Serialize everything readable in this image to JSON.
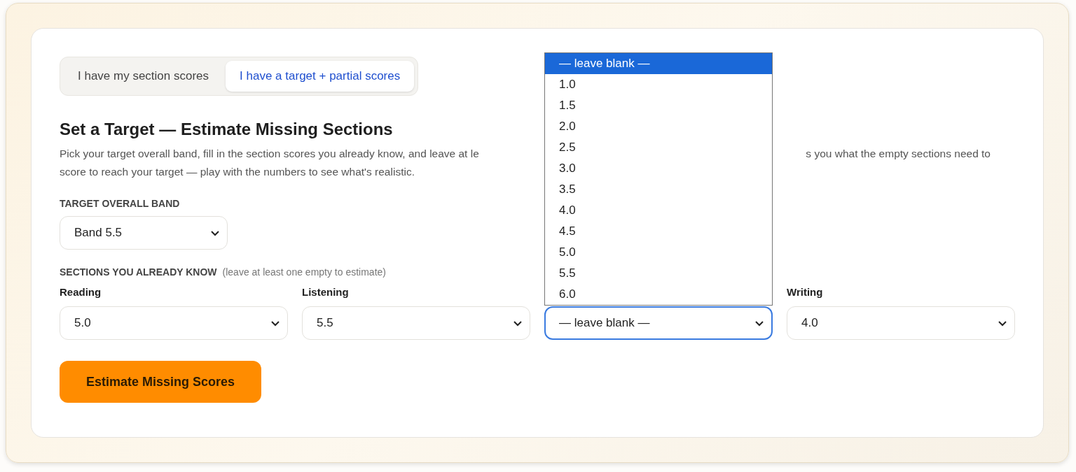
{
  "tabs": [
    {
      "label": "I have my section scores",
      "selected": false
    },
    {
      "label": "I have a target + partial scores",
      "selected": true
    }
  ],
  "heading": "Set a Target — Estimate Missing Sections",
  "description": {
    "line_1_start": "Pick your target overall band, fill in the section scores you already know, and leave at le",
    "line_1_end": "s you what the empty sections need to",
    "line_2": "score to reach your target — play with the numbers to see what's realistic."
  },
  "target": {
    "label": "TARGET OVERALL BAND",
    "value": "Band 5.5"
  },
  "sections": {
    "label": "SECTIONS YOU ALREADY KNOW",
    "hint": "(leave at least one empty to estimate)",
    "fields": [
      {
        "label": "Reading",
        "value": "5.0",
        "focused": false
      },
      {
        "label": "Listening",
        "value": "5.5",
        "focused": false
      },
      {
        "value": "— leave blank —",
        "focused": true,
        "options": [
          {
            "label": "— leave blank —",
            "selected": true
          },
          {
            "label": "1.0",
            "selected": false
          },
          {
            "label": "1.5",
            "selected": false
          },
          {
            "label": "2.0",
            "selected": false
          },
          {
            "label": "2.5",
            "selected": false
          },
          {
            "label": "3.0",
            "selected": false
          },
          {
            "label": "3.5",
            "selected": false
          },
          {
            "label": "4.0",
            "selected": false
          },
          {
            "label": "4.5",
            "selected": false
          },
          {
            "label": "5.0",
            "selected": false
          },
          {
            "label": "5.5",
            "selected": false
          },
          {
            "label": "6.0",
            "selected": false
          }
        ]
      },
      {
        "label": "Writing",
        "value": "4.0",
        "focused": false
      }
    ]
  },
  "button": "Estimate Missing Scores"
}
